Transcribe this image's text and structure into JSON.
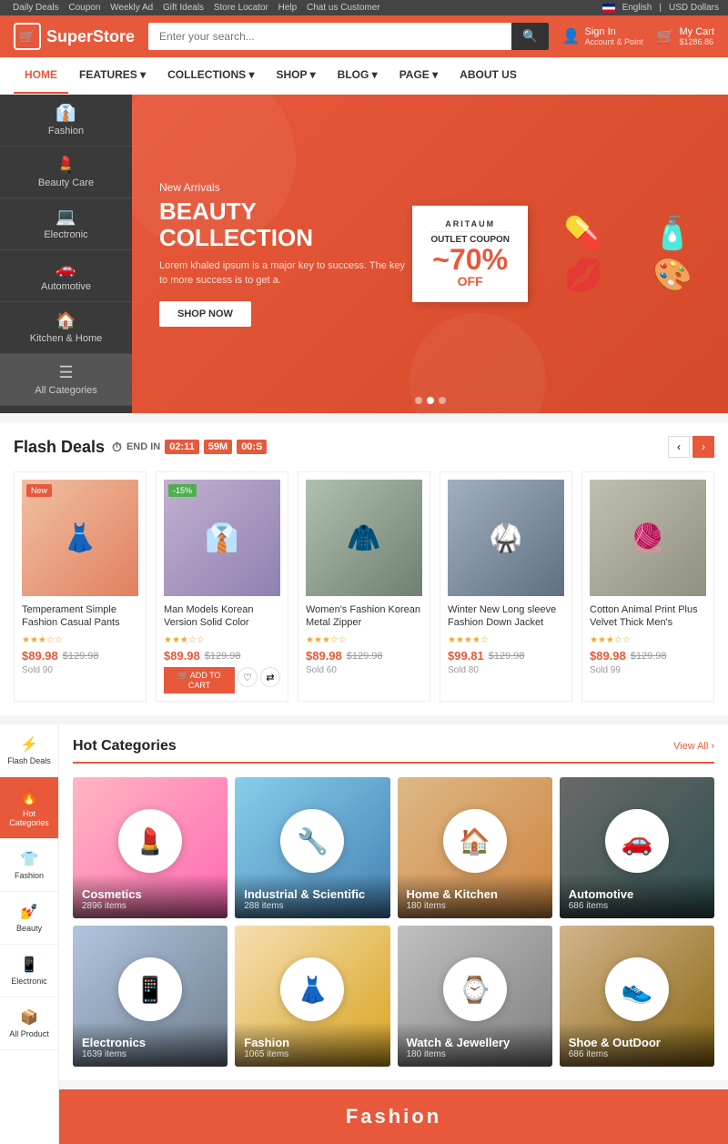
{
  "topbar": {
    "links": [
      "Daily Deals",
      "Coupon",
      "Weekly Ad",
      "Gift Ideals",
      "Store Locator",
      "Help",
      "Chat us Customer"
    ],
    "lang": "English",
    "currency": "USD Dollars"
  },
  "header": {
    "logo": "SuperStore",
    "search_placeholder": "Enter your search...",
    "account_label": "Sign In",
    "account_sub": "Account & Point",
    "cart_label": "My Cart",
    "cart_value": "$1286.86"
  },
  "nav": {
    "items": [
      {
        "label": "HOME",
        "active": true
      },
      {
        "label": "FEATURES",
        "has_dropdown": true
      },
      {
        "label": "COLLECTIONS",
        "has_dropdown": true
      },
      {
        "label": "SHOP",
        "has_dropdown": true
      },
      {
        "label": "BLOG",
        "has_dropdown": true
      },
      {
        "label": "PAGE",
        "has_dropdown": true
      },
      {
        "label": "ABOUT US",
        "has_dropdown": false
      }
    ]
  },
  "sidebar_cats": [
    {
      "icon": "👔",
      "label": "Fashion"
    },
    {
      "icon": "💄",
      "label": "Beauty Care"
    },
    {
      "icon": "💻",
      "label": "Electronic"
    },
    {
      "icon": "🚗",
      "label": "Automotive"
    },
    {
      "icon": "🏠",
      "label": "Kitchen & Home"
    },
    {
      "icon": "☰",
      "label": "All Categories"
    }
  ],
  "hero": {
    "subtitle": "New Arrivals",
    "title": "BEAUTY COLLECTION",
    "desc": "Lorem khaled ipsum is a major key to success. The key to more success is to get a.",
    "btn_label": "SHOP NOW",
    "coupon_label": "OUTLET COUPON",
    "coupon_percent": "~70%",
    "coupon_off": "OFF"
  },
  "flash_deals": {
    "title": "Flash Deals",
    "end_in": "END IN",
    "timer": {
      "hours": "02:11",
      "minutes": "59M",
      "seconds": "00:S"
    },
    "products": [
      {
        "name": "Temperament Simple Fashion Casual Pants",
        "stars": 3,
        "price_new": "$89.98",
        "price_old": "$129.98",
        "sold": "Sold 90",
        "badge": "New",
        "badge_type": "orange"
      },
      {
        "name": "Man Models Korean Version Solid Color",
        "stars": 3,
        "price_new": "$89.98",
        "price_old": "$129.98",
        "sold": "",
        "badge": "-15%",
        "badge_type": "green"
      },
      {
        "name": "Women's Fashion Korean Metal Zipper",
        "stars": 3,
        "price_new": "$89.98",
        "price_old": "$129.98",
        "sold": "Sold 60",
        "badge": "",
        "badge_type": ""
      },
      {
        "name": "Winter New Long sleeve Fashion Down Jacket",
        "stars": 4,
        "price_new": "$99.81",
        "price_old": "$129.98",
        "sold": "Sold 80",
        "badge": "",
        "badge_type": ""
      },
      {
        "name": "Cotton Animal Print Plus Velvet Thick Men's Sweater",
        "stars": 3,
        "price_new": "$89.98",
        "price_old": "$129.98",
        "sold": "Sold 99",
        "badge": "",
        "badge_type": ""
      }
    ]
  },
  "left_sidebar": {
    "items": [
      {
        "icon": "⚡",
        "label": "Flash Deals",
        "active": false
      },
      {
        "icon": "🔥",
        "label": "Hot Categories",
        "active": true
      },
      {
        "icon": "👕",
        "label": "Fashion",
        "active": false
      },
      {
        "icon": "💅",
        "label": "Beauty",
        "active": false
      },
      {
        "icon": "📱",
        "label": "Electronic",
        "active": false
      },
      {
        "icon": "📦",
        "label": "All Product",
        "active": false
      }
    ]
  },
  "hot_categories": {
    "title": "Hot Categories",
    "view_all": "View All",
    "categories": [
      {
        "name": "Cosmetics",
        "count": "2896 items",
        "icon": "💄",
        "class": "cat-cosmetics"
      },
      {
        "name": "Industrial & Scientific",
        "count": "288 items",
        "icon": "🔧",
        "class": "cat-industrial"
      },
      {
        "name": "Home & Kitchen",
        "count": "180 items",
        "icon": "🏠",
        "class": "cat-home"
      },
      {
        "name": "Automotive",
        "count": "686 items",
        "icon": "🚗",
        "class": "cat-automotive"
      },
      {
        "name": "Electronics",
        "count": "1639 items",
        "icon": "📱",
        "class": "cat-electronics"
      },
      {
        "name": "Fashion",
        "count": "1065 items",
        "icon": "👗",
        "class": "cat-fashion"
      },
      {
        "name": "Watch & Jewellery",
        "count": "180 items",
        "icon": "⌚",
        "class": "cat-watch"
      },
      {
        "name": "Shoe & OutDoor",
        "count": "686 items",
        "icon": "👟",
        "class": "cat-shoe"
      }
    ]
  },
  "fashion_section": {
    "label": "Fashion"
  },
  "colors": {
    "primary": "#e8583a",
    "dark": "#3a3a3a",
    "light_bg": "#f5f5f5"
  }
}
